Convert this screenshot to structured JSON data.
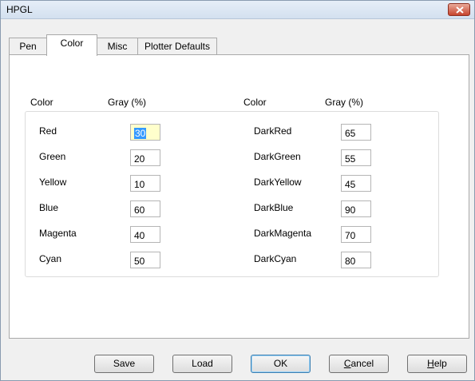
{
  "window": {
    "title": "HPGL"
  },
  "tabs": [
    {
      "label": "Pen"
    },
    {
      "label": "Color"
    },
    {
      "label": "Misc"
    },
    {
      "label": "Plotter Defaults"
    }
  ],
  "headers": {
    "left_color": "Color",
    "left_gray": "Gray (%)",
    "right_color": "Color",
    "right_gray": "Gray (%)"
  },
  "left_rows": [
    {
      "label": "Red",
      "value": "30"
    },
    {
      "label": "Green",
      "value": "20"
    },
    {
      "label": "Yellow",
      "value": "10"
    },
    {
      "label": "Blue",
      "value": "60"
    },
    {
      "label": "Magenta",
      "value": "40"
    },
    {
      "label": "Cyan",
      "value": "50"
    }
  ],
  "right_rows": [
    {
      "label": "DarkRed",
      "value": "65"
    },
    {
      "label": "DarkGreen",
      "value": "55"
    },
    {
      "label": "DarkYellow",
      "value": "45"
    },
    {
      "label": "DarkBlue",
      "value": "90"
    },
    {
      "label": "DarkMagenta",
      "value": "70"
    },
    {
      "label": "DarkCyan",
      "value": "80"
    }
  ],
  "buttons": {
    "save": "Save",
    "load": "Load",
    "ok": "OK",
    "cancel_pre": "",
    "cancel_mnemonic": "C",
    "cancel_post": "ancel",
    "help_pre": "",
    "help_mnemonic": "H",
    "help_post": "elp"
  },
  "icons": {
    "close": "close-icon"
  },
  "colors": {
    "focused_input_bg": "#ffffcc",
    "selection": "#3399ff",
    "close_button": "#c7442d"
  }
}
